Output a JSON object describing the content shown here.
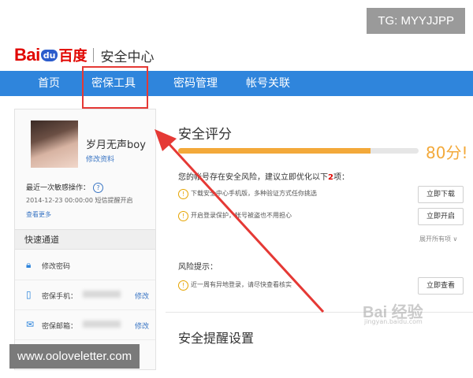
{
  "watermarks": {
    "tg": "TG: MYYJJPP",
    "url": "www.ooloveletter.com",
    "jingyan": "Bai 经验",
    "jingyan_url": "jingyan.baidu.com"
  },
  "header": {
    "logo_bai": "Bai",
    "logo_du": "du",
    "logo_cn": "百度",
    "title": "安全中心"
  },
  "nav": {
    "items": [
      {
        "label": "首页"
      },
      {
        "label": "密保工具"
      },
      {
        "label": "密码管理"
      },
      {
        "label": "帐号关联"
      }
    ],
    "active_color": "#2f85dc"
  },
  "sidebar": {
    "user_name": "岁月无声boy",
    "edit_profile": "修改资料",
    "last_op_label": "最近一次敏感操作：",
    "help": "?",
    "last_op_detail": "2014-12-23 00:00:00   短信提醒开启",
    "see_more": "查看更多",
    "quick_title": "快速通道",
    "quick_items": [
      {
        "icon": "lock-icon",
        "label": "修改密码"
      },
      {
        "icon": "phone-icon",
        "label": "密保手机：",
        "edit": "修改"
      },
      {
        "icon": "mail-icon",
        "label": "密保邮箱：",
        "edit": "修改"
      }
    ]
  },
  "main": {
    "title": "安全评分",
    "score": "80分!",
    "score_value": 80,
    "risk_summary_pre": "您的帐号存在安全风险，建议立即优化以下",
    "risk_count": "2",
    "risk_summary_post": "项：",
    "tips": [
      {
        "text": "下载安全中心手机版，多种验证方式任你挑选",
        "button": "立即下载"
      },
      {
        "text": "开启登录保护，帐号被盗也不用担心",
        "button": "立即开启"
      }
    ],
    "expand": "展开所有项 ∨",
    "risk_tip_title": "风险提示：",
    "risk_tip": {
      "text": "近一周有异地登录，请尽快查看核实",
      "button": "立即查看"
    },
    "reminder_title": "安全提醒设置"
  },
  "colors": {
    "nav_blue": "#2f85dc",
    "score_orange": "#f3a93a",
    "brand_red": "#e10601",
    "annotation_red": "#e53935"
  }
}
